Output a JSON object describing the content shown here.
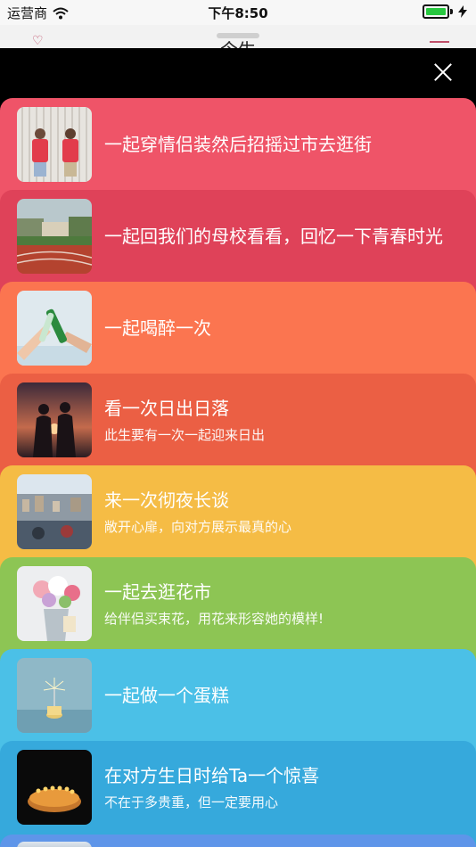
{
  "status": {
    "carrier": "运营商",
    "time": "下午8:50"
  },
  "nav": {
    "title": "今生"
  },
  "cards": [
    {
      "title": "一起穿情侣装然后招摇过市去逛街",
      "subtitle": "",
      "color": "#ef5468"
    },
    {
      "title": "一起回我们的母校看看，回忆一下青春时光",
      "subtitle": "",
      "color": "#df4259"
    },
    {
      "title": "一起喝醉一次",
      "subtitle": "",
      "color": "#fb7550"
    },
    {
      "title": "看一次日出日落",
      "subtitle": "此生要有一次一起迎来日出",
      "color": "#eb5f44"
    },
    {
      "title": "来一次彻夜长谈",
      "subtitle": "敞开心扉，向对方展示最真的心",
      "color": "#f5bc45"
    },
    {
      "title": "一起去逛花市",
      "subtitle": "给伴侣买束花，用花来形容她的模样!",
      "color": "#8dc554"
    },
    {
      "title": "一起做一个蛋糕",
      "subtitle": "",
      "color": "#4bc0e7"
    },
    {
      "title": "在对方生日时给Ta一个惊喜",
      "subtitle": "不在于多贵重，但一定要用心",
      "color": "#36a9dc"
    }
  ],
  "peek_color": "#5e95e9",
  "icons": {
    "wifi": "wifi-icon",
    "close": "close-icon"
  }
}
